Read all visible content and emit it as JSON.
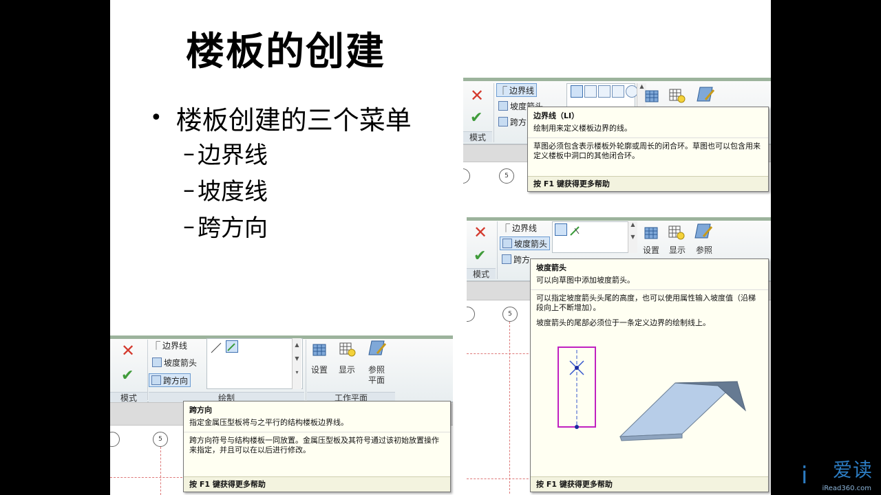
{
  "slide": {
    "title": "楼板的创建",
    "bullet": "楼板创建的三个菜单",
    "dash": "–",
    "sub_items": [
      "边界线",
      "坡度线",
      "跨方向"
    ]
  },
  "ribbon": {
    "mode_label": "模式",
    "draw_label": "绘制",
    "workplane_label": "工作平面",
    "tools": {
      "boundary": "边界线",
      "slope_arrow": "坡度箭头",
      "span_direction": "跨方向",
      "span_direction_partial": "跨方",
      "span_direction_partial2": "跨方向"
    },
    "wp": {
      "set": "设置",
      "show": "显示",
      "ref_plane_1": "参照",
      "ref_plane_2": "平面"
    },
    "grid_number": "5"
  },
  "tooltips": {
    "boundary": {
      "title": "边界线（LI）",
      "summary": "绘制用来定义楼板边界的线。",
      "body": "草图必须包含表示楼板外轮廓或周长的闭合环。草图也可以包含用来定义楼板中洞口的其他闭合环。",
      "footer": "按 F1 键获得更多帮助"
    },
    "slope": {
      "title": "坡度箭头",
      "summary": "可以向草图中添加坡度箭头。",
      "body1": "可以指定坡度箭头头尾的高度，也可以使用属性输入坡度值（沿梯段向上不断增加）。",
      "body2": "坡度箭头的尾部必须位于一条定义边界的绘制线上。",
      "footer": "按 F1 键获得更多帮助"
    },
    "span": {
      "title": "跨方向",
      "summary": "指定金属压型板将与之平行的结构楼板边界线。",
      "body": "跨方向符号与结构楼板一同放置。金属压型板及其符号通过该初始放置操作来指定，并且可以在以后进行修改。",
      "footer": "按 F1 键获得更多帮助"
    }
  },
  "logo": {
    "mark": "i",
    "text": "爱读",
    "sub": "iRead360.com"
  },
  "colors": {
    "slope_rect": "#c020c0",
    "slab": "#b7cde8",
    "accent": "#2c7cc2"
  }
}
